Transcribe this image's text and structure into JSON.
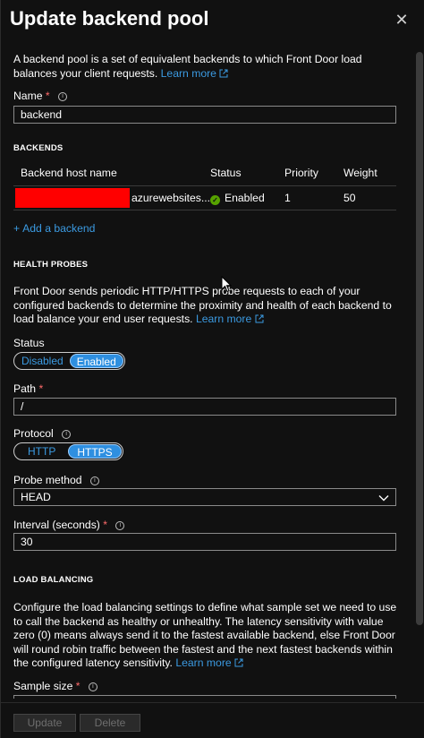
{
  "panel": {
    "title": "Update backend pool",
    "close_glyph": "✕"
  },
  "intro": {
    "text": "A backend pool is a set of equivalent backends to which Front Door load balances your client requests.",
    "link": "Learn more"
  },
  "name_field": {
    "label": "Name",
    "required_mark": "*",
    "value": "backend"
  },
  "backends": {
    "section_title": "BACKENDS",
    "columns": [
      "Backend host name",
      "Status",
      "Priority",
      "Weight"
    ],
    "rows": [
      {
        "host_suffix": "azurewebsites....",
        "status": "Enabled",
        "priority": "1",
        "weight": "50"
      }
    ],
    "add_label": "Add a backend",
    "add_glyph": "+"
  },
  "health_probes": {
    "section_title": "HEALTH PROBES",
    "text": "Front Door sends periodic HTTP/HTTPS probe requests to each of your configured backends to determine the proximity and health of each backend to load balance your end user requests.",
    "link": "Learn more",
    "status_label": "Status",
    "status_options": [
      "Disabled",
      "Enabled"
    ],
    "status_selected": "Enabled",
    "path_label": "Path",
    "path_value": "/",
    "protocol_label": "Protocol",
    "protocol_options": [
      "HTTP",
      "HTTPS"
    ],
    "protocol_selected": "HTTPS",
    "method_label": "Probe method",
    "method_value": "HEAD",
    "interval_label": "Interval (seconds)",
    "interval_value": "30"
  },
  "load_balancing": {
    "section_title": "LOAD BALANCING",
    "text": "Configure the load balancing settings to define what sample set we need to use to call the backend as healthy or unhealthy. The latency sensitivity with value zero (0) means always send it to the fastest available backend, else Front Door will round robin traffic between the fastest and the next fastest backends within the configured latency sensitivity.",
    "link": "Learn more",
    "sample_size_label": "Sample size"
  },
  "footer": {
    "update_label": "Update",
    "delete_label": "Delete"
  },
  "colors": {
    "background": "#111111",
    "link": "#3b9ae1",
    "accent": "#2e8fe0",
    "status_ok": "#57a300",
    "required": "#ff6b6b"
  },
  "icons": [
    "close-icon",
    "external-link-icon",
    "info-icon",
    "check-circle-icon",
    "plus-icon",
    "chevron-down-icon",
    "mouse-pointer-icon"
  ]
}
